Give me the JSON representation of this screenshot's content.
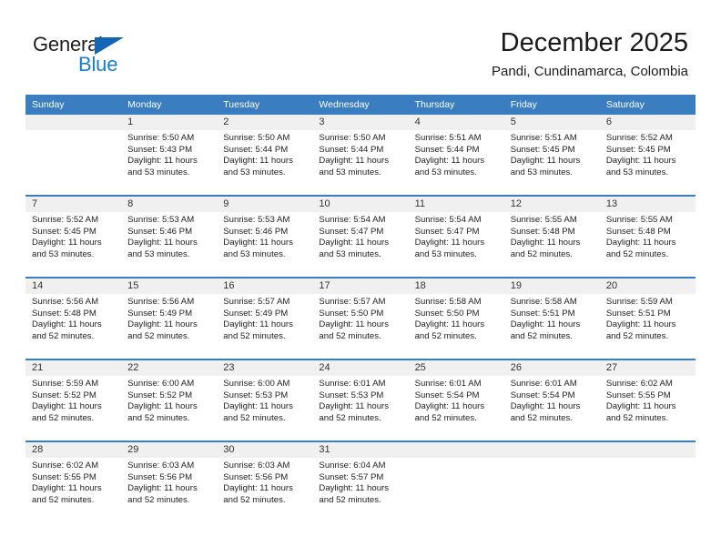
{
  "brand": {
    "name_part1": "General",
    "name_part2": "Blue",
    "accent_color": "#1a7ec8",
    "triangle_color": "#1565b5"
  },
  "header": {
    "title": "December 2025",
    "subtitle": "Pandi, Cundinamarca, Colombia"
  },
  "calendar": {
    "header_bg": "#3a7dc0",
    "daynum_bg": "#f0f0f0",
    "weekdays": [
      "Sunday",
      "Monday",
      "Tuesday",
      "Wednesday",
      "Thursday",
      "Friday",
      "Saturday"
    ],
    "weeks": [
      [
        {
          "day": "",
          "sunrise": "",
          "sunset": "",
          "daylight": "",
          "empty": true
        },
        {
          "day": "1",
          "sunrise": "Sunrise: 5:50 AM",
          "sunset": "Sunset: 5:43 PM",
          "daylight": "Daylight: 11 hours and 53 minutes."
        },
        {
          "day": "2",
          "sunrise": "Sunrise: 5:50 AM",
          "sunset": "Sunset: 5:44 PM",
          "daylight": "Daylight: 11 hours and 53 minutes."
        },
        {
          "day": "3",
          "sunrise": "Sunrise: 5:50 AM",
          "sunset": "Sunset: 5:44 PM",
          "daylight": "Daylight: 11 hours and 53 minutes."
        },
        {
          "day": "4",
          "sunrise": "Sunrise: 5:51 AM",
          "sunset": "Sunset: 5:44 PM",
          "daylight": "Daylight: 11 hours and 53 minutes."
        },
        {
          "day": "5",
          "sunrise": "Sunrise: 5:51 AM",
          "sunset": "Sunset: 5:45 PM",
          "daylight": "Daylight: 11 hours and 53 minutes."
        },
        {
          "day": "6",
          "sunrise": "Sunrise: 5:52 AM",
          "sunset": "Sunset: 5:45 PM",
          "daylight": "Daylight: 11 hours and 53 minutes."
        }
      ],
      [
        {
          "day": "7",
          "sunrise": "Sunrise: 5:52 AM",
          "sunset": "Sunset: 5:45 PM",
          "daylight": "Daylight: 11 hours and 53 minutes."
        },
        {
          "day": "8",
          "sunrise": "Sunrise: 5:53 AM",
          "sunset": "Sunset: 5:46 PM",
          "daylight": "Daylight: 11 hours and 53 minutes."
        },
        {
          "day": "9",
          "sunrise": "Sunrise: 5:53 AM",
          "sunset": "Sunset: 5:46 PM",
          "daylight": "Daylight: 11 hours and 53 minutes."
        },
        {
          "day": "10",
          "sunrise": "Sunrise: 5:54 AM",
          "sunset": "Sunset: 5:47 PM",
          "daylight": "Daylight: 11 hours and 53 minutes."
        },
        {
          "day": "11",
          "sunrise": "Sunrise: 5:54 AM",
          "sunset": "Sunset: 5:47 PM",
          "daylight": "Daylight: 11 hours and 53 minutes."
        },
        {
          "day": "12",
          "sunrise": "Sunrise: 5:55 AM",
          "sunset": "Sunset: 5:48 PM",
          "daylight": "Daylight: 11 hours and 52 minutes."
        },
        {
          "day": "13",
          "sunrise": "Sunrise: 5:55 AM",
          "sunset": "Sunset: 5:48 PM",
          "daylight": "Daylight: 11 hours and 52 minutes."
        }
      ],
      [
        {
          "day": "14",
          "sunrise": "Sunrise: 5:56 AM",
          "sunset": "Sunset: 5:48 PM",
          "daylight": "Daylight: 11 hours and 52 minutes."
        },
        {
          "day": "15",
          "sunrise": "Sunrise: 5:56 AM",
          "sunset": "Sunset: 5:49 PM",
          "daylight": "Daylight: 11 hours and 52 minutes."
        },
        {
          "day": "16",
          "sunrise": "Sunrise: 5:57 AM",
          "sunset": "Sunset: 5:49 PM",
          "daylight": "Daylight: 11 hours and 52 minutes."
        },
        {
          "day": "17",
          "sunrise": "Sunrise: 5:57 AM",
          "sunset": "Sunset: 5:50 PM",
          "daylight": "Daylight: 11 hours and 52 minutes."
        },
        {
          "day": "18",
          "sunrise": "Sunrise: 5:58 AM",
          "sunset": "Sunset: 5:50 PM",
          "daylight": "Daylight: 11 hours and 52 minutes."
        },
        {
          "day": "19",
          "sunrise": "Sunrise: 5:58 AM",
          "sunset": "Sunset: 5:51 PM",
          "daylight": "Daylight: 11 hours and 52 minutes."
        },
        {
          "day": "20",
          "sunrise": "Sunrise: 5:59 AM",
          "sunset": "Sunset: 5:51 PM",
          "daylight": "Daylight: 11 hours and 52 minutes."
        }
      ],
      [
        {
          "day": "21",
          "sunrise": "Sunrise: 5:59 AM",
          "sunset": "Sunset: 5:52 PM",
          "daylight": "Daylight: 11 hours and 52 minutes."
        },
        {
          "day": "22",
          "sunrise": "Sunrise: 6:00 AM",
          "sunset": "Sunset: 5:52 PM",
          "daylight": "Daylight: 11 hours and 52 minutes."
        },
        {
          "day": "23",
          "sunrise": "Sunrise: 6:00 AM",
          "sunset": "Sunset: 5:53 PM",
          "daylight": "Daylight: 11 hours and 52 minutes."
        },
        {
          "day": "24",
          "sunrise": "Sunrise: 6:01 AM",
          "sunset": "Sunset: 5:53 PM",
          "daylight": "Daylight: 11 hours and 52 minutes."
        },
        {
          "day": "25",
          "sunrise": "Sunrise: 6:01 AM",
          "sunset": "Sunset: 5:54 PM",
          "daylight": "Daylight: 11 hours and 52 minutes."
        },
        {
          "day": "26",
          "sunrise": "Sunrise: 6:01 AM",
          "sunset": "Sunset: 5:54 PM",
          "daylight": "Daylight: 11 hours and 52 minutes."
        },
        {
          "day": "27",
          "sunrise": "Sunrise: 6:02 AM",
          "sunset": "Sunset: 5:55 PM",
          "daylight": "Daylight: 11 hours and 52 minutes."
        }
      ],
      [
        {
          "day": "28",
          "sunrise": "Sunrise: 6:02 AM",
          "sunset": "Sunset: 5:55 PM",
          "daylight": "Daylight: 11 hours and 52 minutes."
        },
        {
          "day": "29",
          "sunrise": "Sunrise: 6:03 AM",
          "sunset": "Sunset: 5:56 PM",
          "daylight": "Daylight: 11 hours and 52 minutes."
        },
        {
          "day": "30",
          "sunrise": "Sunrise: 6:03 AM",
          "sunset": "Sunset: 5:56 PM",
          "daylight": "Daylight: 11 hours and 52 minutes."
        },
        {
          "day": "31",
          "sunrise": "Sunrise: 6:04 AM",
          "sunset": "Sunset: 5:57 PM",
          "daylight": "Daylight: 11 hours and 52 minutes."
        },
        {
          "day": "",
          "sunrise": "",
          "sunset": "",
          "daylight": "",
          "empty": true
        },
        {
          "day": "",
          "sunrise": "",
          "sunset": "",
          "daylight": "",
          "empty": true
        },
        {
          "day": "",
          "sunrise": "",
          "sunset": "",
          "daylight": "",
          "empty": true
        }
      ]
    ]
  }
}
